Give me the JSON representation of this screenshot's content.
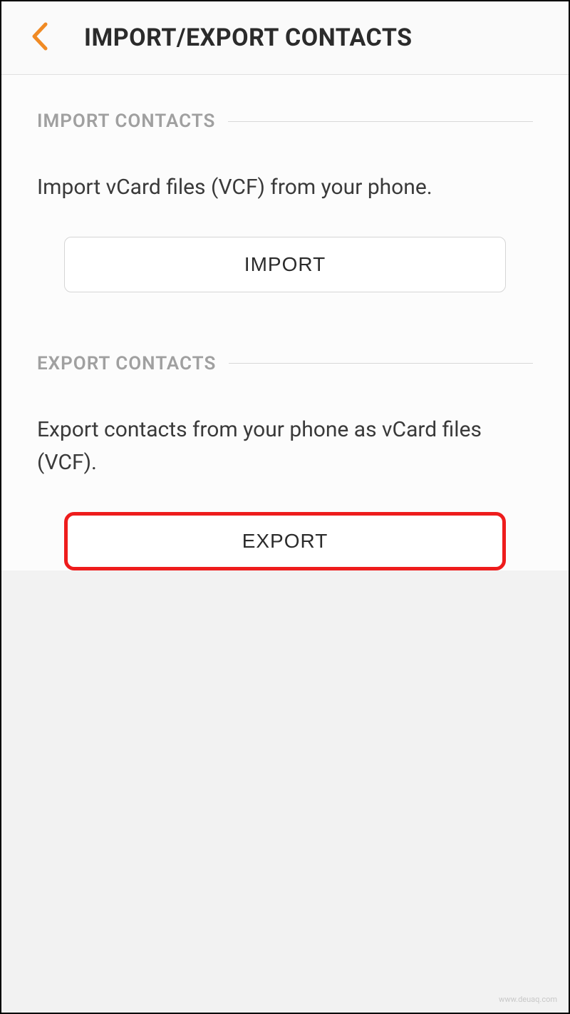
{
  "header": {
    "title": "IMPORT/EXPORT CONTACTS"
  },
  "sections": {
    "import": {
      "heading": "IMPORT CONTACTS",
      "description": "Import vCard files (VCF) from your phone.",
      "button_label": "IMPORT"
    },
    "export": {
      "heading": "EXPORT CONTACTS",
      "description": "Export contacts from your phone as vCard files (VCF).",
      "button_label": "EXPORT"
    }
  },
  "colors": {
    "accent": "#f08a24",
    "highlight": "#ee1c1c"
  },
  "watermark": "www.deuaq.com"
}
